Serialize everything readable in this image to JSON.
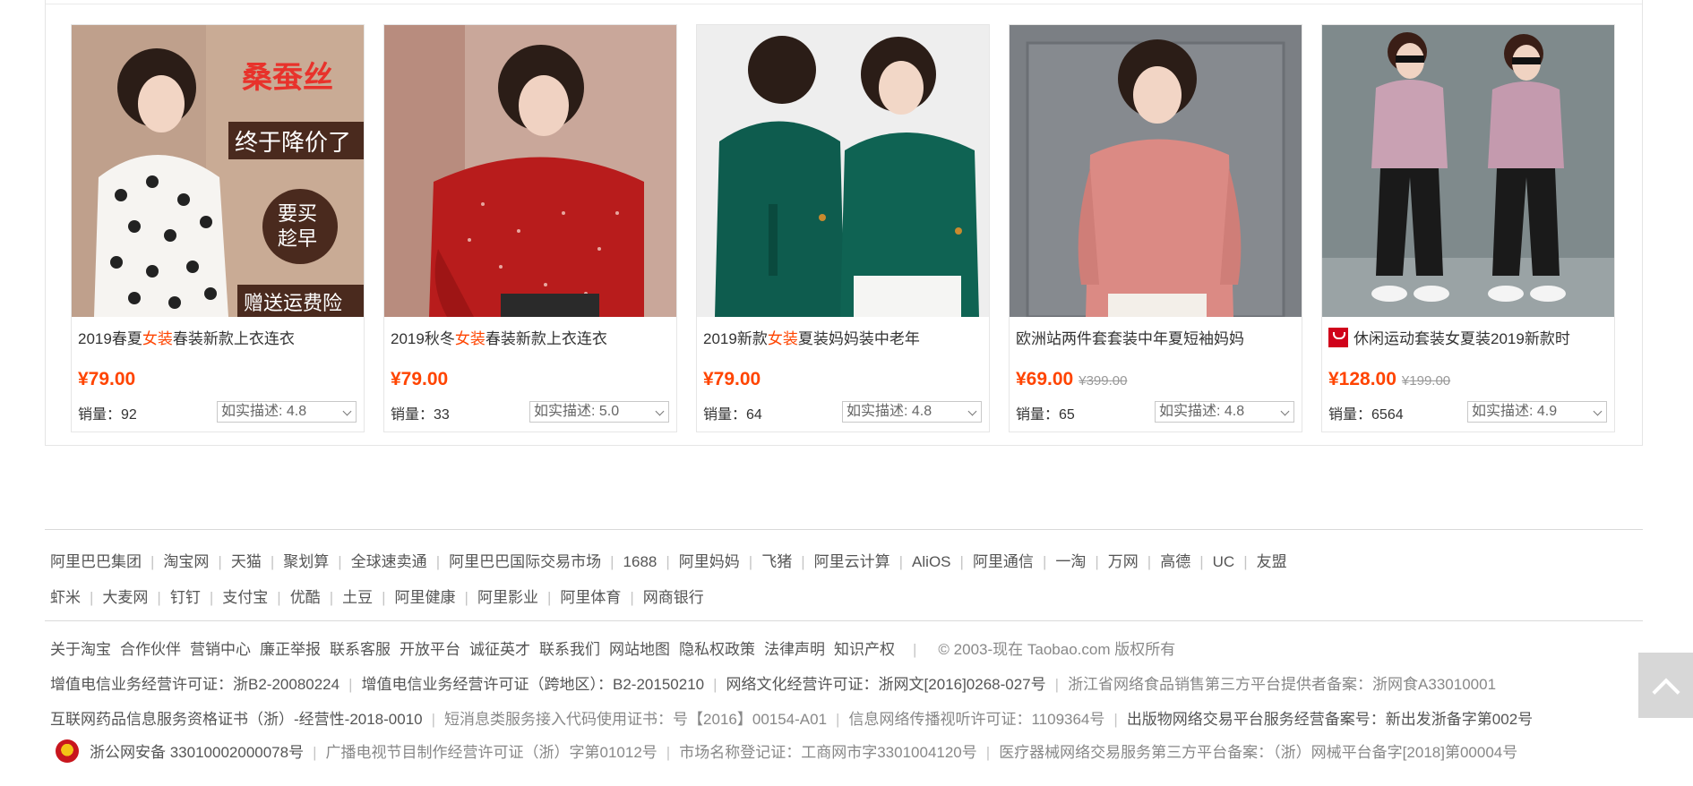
{
  "products": [
    {
      "title_pre": "2019春夏",
      "title_hl": "女装",
      "title_post": "春装新款上衣连衣",
      "price": "¥79.00",
      "old_price": "",
      "sales_label": "销量：",
      "sales": "92",
      "rating": "如实描述: 4.8",
      "image_text": [
        "桑蚕丝",
        "终于降价了",
        "要买",
        "趁早",
        "赠送运费险"
      ]
    },
    {
      "title_pre": "2019秋冬",
      "title_hl": "女装",
      "title_post": "春装新款上衣连衣",
      "price": "¥79.00",
      "old_price": "",
      "sales_label": "销量：",
      "sales": "33",
      "rating": "如实描述: 5.0",
      "image_text": []
    },
    {
      "title_pre": "2019新款",
      "title_hl": "女装",
      "title_post": "夏装妈妈装中老年",
      "price": "¥79.00",
      "old_price": "",
      "sales_label": "销量：",
      "sales": "64",
      "rating": "如实描述: 4.8",
      "image_text": []
    },
    {
      "title_pre": "欧洲站两件套套装中年夏短袖妈妈",
      "title_hl": "",
      "title_post": "",
      "price": "¥69.00",
      "old_price": "¥399.00",
      "sales_label": "销量：",
      "sales": "65",
      "rating": "如实描述: 4.8",
      "image_text": []
    },
    {
      "title_pre": "休闲运动套装女夏装2019新款时",
      "title_hl": "",
      "title_post": "",
      "price": "¥128.00",
      "old_price": "¥199.00",
      "sales_label": "销量：",
      "sales": "6564",
      "rating": "如实描述: 4.9",
      "image_text": []
    }
  ],
  "footer": {
    "group_links_row1": [
      "阿里巴巴集团",
      "淘宝网",
      "天猫",
      "聚划算",
      "全球速卖通",
      "阿里巴巴国际交易市场",
      "1688",
      "阿里妈妈",
      "飞猪",
      "阿里云计算",
      "AliOS",
      "阿里通信",
      "一淘",
      "万网",
      "高德",
      "UC",
      "友盟"
    ],
    "group_links_row2": [
      "虾米",
      "大麦网",
      "钉钉",
      "支付宝",
      "优酷",
      "土豆",
      "阿里健康",
      "阿里影业",
      "阿里体育",
      "网商银行"
    ],
    "about_links": [
      "关于淘宝",
      "合作伙伴",
      "营销中心",
      "廉正举报",
      "联系客服",
      "开放平台",
      "诚征英才",
      "联系我们",
      "网站地图",
      "隐私权政策",
      "法律声明",
      "知识产权"
    ],
    "copyright": "© 2003-现在 Taobao.com 版权所有",
    "license_row1": [
      "增值电信业务经营许可证：浙B2-20080224",
      "增值电信业务经营许可证（跨地区）：B2-20150210",
      "网络文化经营许可证：浙网文[2016]0268-027号",
      "浙江省网络食品销售第三方平台提供者备案：浙网食A33010001"
    ],
    "license_row2": [
      "互联网药品信息服务资格证书（浙）-经营性-2018-0010",
      "短消息类服务接入代码使用证书：号【2016】00154-A01",
      "信息网络传播视听许可证：1109364号",
      "出版物网络交易平台服务经营备案号：新出发浙备字第002号"
    ],
    "license_row3": [
      "浙公网安备 33010002000078号",
      "广播电视节目制作经营许可证（浙）字第01012号",
      "市场名称登记证：工商网市字3301004120号",
      "医疗器械网络交易服务第三方平台备案：（浙）网械平台备字[2018]第00004号"
    ]
  },
  "colors": {
    "price": "#ff4400",
    "highlight": "#ff4400"
  },
  "icons": {
    "back_top": "chevron-up-icon",
    "police": "police-badge-icon",
    "tmall": "tmall-badge-icon"
  }
}
